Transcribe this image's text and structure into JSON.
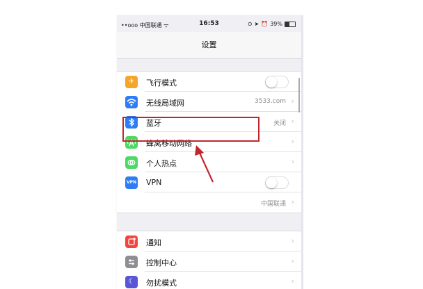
{
  "status_bar": {
    "carrier": "••ooo 中国联通 ᯤ",
    "time": "16:53",
    "battery_text": "39%"
  },
  "navbar": {
    "title": "设置"
  },
  "group1": {
    "items": [
      {
        "label": "飞行模式",
        "icon": "airplane-icon",
        "icon_color": "#f4a52a",
        "control": "toggle-off"
      },
      {
        "label": "无线局域网",
        "value": "3533.com",
        "icon": "wifi-icon",
        "icon_color": "#2f7df6",
        "control": "chevron"
      },
      {
        "label": "蓝牙",
        "value": "关闭",
        "icon": "bluetooth-icon",
        "icon_color": "#2f7df6",
        "control": "chevron"
      },
      {
        "label": "蜂窝移动网络",
        "icon": "cellular-icon",
        "icon_color": "#4cd964",
        "control": "chevron"
      },
      {
        "label": "个人热点",
        "icon": "hotspot-icon",
        "icon_color": "#4cd964",
        "control": "chevron"
      },
      {
        "label": "VPN",
        "icon": "vpn-icon",
        "icon_glyph": "VPN",
        "icon_color": "#2f7df6",
        "control": "toggle-off"
      },
      {
        "label": "",
        "value": "中国联通",
        "control": "chevron"
      }
    ]
  },
  "group2": {
    "items": [
      {
        "label": "通知",
        "icon": "notifications-icon",
        "icon_color": "#f2453d",
        "control": "chevron"
      },
      {
        "label": "控制中心",
        "icon": "control-center-icon",
        "icon_color": "#8e8e93",
        "control": "chevron"
      },
      {
        "label": "勿扰模式",
        "icon": "do-not-disturb-icon",
        "icon_color": "#5856d6",
        "control": "chevron"
      }
    ]
  },
  "colors": {
    "highlight": "#c0272d",
    "background": "#efeff4"
  }
}
